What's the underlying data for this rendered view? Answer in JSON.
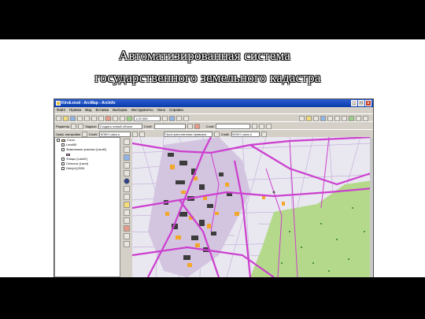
{
  "slide": {
    "title_line1": "Автоматизированная система",
    "title_line2": "государственного земельного кадастра"
  },
  "window": {
    "title": "Kirsk.mxd - ArcMap - ArcInfo",
    "buttons": {
      "minimize": "_",
      "maximize": "□",
      "close": "x"
    }
  },
  "menu": [
    "Файл",
    "Правка",
    "Вид",
    "Вставка",
    "Выборка",
    "Инструменты",
    "Окно",
    "Справка"
  ],
  "toolbar": {
    "scale_value": "1:25 565",
    "editor_label": "Редактор",
    "task_label": "Задача:",
    "task_value": "Создать новый объект",
    "target_label": "Слой:",
    "spatial_label": "Пространственная привязка",
    "layer_label": "Слой:",
    "layer_value": "КЛКН  l-asia.a",
    "layer2_value": "КЛКН  l-asia.a",
    "tools_label": "Граф. настройки",
    "georef_label": "Слой:"
  },
  "toc": {
    "root": "Слои",
    "layers": [
      {
        "label": "Land50",
        "swatch": ""
      },
      {
        "label": "Земельные участки (Land2)",
        "swatch": "#d98ad0"
      },
      {
        "label": "Улицы (Land2)",
        "swatch": ""
      },
      {
        "label": "Сельхоз (Land)",
        "swatch": ""
      },
      {
        "label": "Geb(v1)2026",
        "swatch": ""
      }
    ]
  },
  "map": {
    "colors": {
      "background": "#e9e7f0",
      "parcels": "#c9b7d8",
      "roads": "#cc3fcf",
      "settlement_blocks": "#3c3c3c",
      "houses": "#f2a62a",
      "forest": "#b4d98a",
      "forest_dark": "#2e7c2e",
      "grid": "#b89ed0"
    }
  }
}
